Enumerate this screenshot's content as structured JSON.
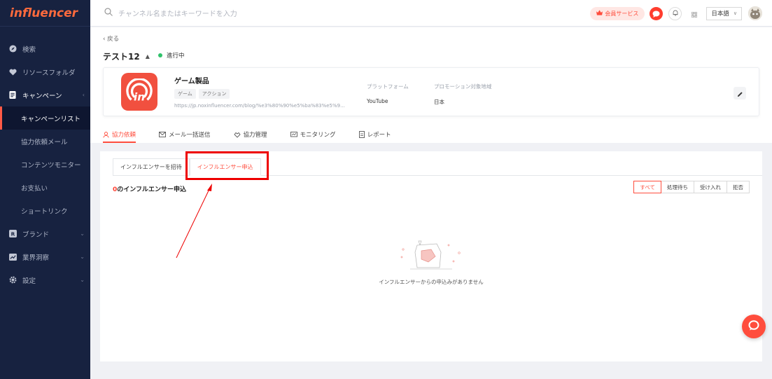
{
  "brand": {
    "logo_text": "influencer",
    "accent": "#ff4d3d"
  },
  "sidebar": {
    "items": [
      {
        "label": "検索",
        "icon": "compass-icon"
      },
      {
        "label": "リソースフォルダ",
        "icon": "heart-icon"
      },
      {
        "label": "キャンペーン",
        "icon": "document-icon",
        "expanded": true,
        "children": [
          {
            "label": "キャンペーンリスト",
            "active": true
          },
          {
            "label": "協力依頼メール"
          },
          {
            "label": "コンテンツモニター"
          },
          {
            "label": "お支払い"
          },
          {
            "label": "ショートリンク"
          }
        ]
      },
      {
        "label": "ブランド",
        "icon": "brand-icon"
      },
      {
        "label": "業界洞察",
        "icon": "chart-icon"
      },
      {
        "label": "設定",
        "icon": "gear-icon"
      }
    ]
  },
  "topbar": {
    "search_placeholder": "チャンネル名またはキーワードを入力",
    "vip_label": "会員サービス",
    "language": "日本語"
  },
  "header": {
    "back_label": "戻る",
    "campaign_name": "テスト12",
    "status": "進行中"
  },
  "product": {
    "name": "ゲーム製品",
    "tags": [
      "ゲーム",
      "アクション"
    ],
    "url": "https://jp.noxinfluencer.com/blog/%e3%80%90%e5%ba%83%e5%9...",
    "platform_label": "プラットフォーム",
    "platform_value": "YouTube",
    "region_label": "プロモーション対象地域",
    "region_value": "日本"
  },
  "tabs": [
    {
      "label": "協力依頼",
      "icon": "person-icon",
      "active": true
    },
    {
      "label": "メール一括送信",
      "icon": "mail-icon"
    },
    {
      "label": "協力管理",
      "icon": "handshake-icon"
    },
    {
      "label": "モニタリング",
      "icon": "monitor-icon"
    },
    {
      "label": "レポート",
      "icon": "report-icon"
    }
  ],
  "subtabs": [
    {
      "label": "インフルエンサーを招待"
    },
    {
      "label": "インフルエンサー申込",
      "active": true
    }
  ],
  "applications": {
    "count": "0",
    "count_suffix": "のインフルエンサー申込",
    "filters": [
      {
        "label": "すべて",
        "active": true
      },
      {
        "label": "処理待ち"
      },
      {
        "label": "受け入れ"
      },
      {
        "label": "拒否"
      }
    ],
    "empty_message": "インフルエンサーからの申込みがありません"
  }
}
